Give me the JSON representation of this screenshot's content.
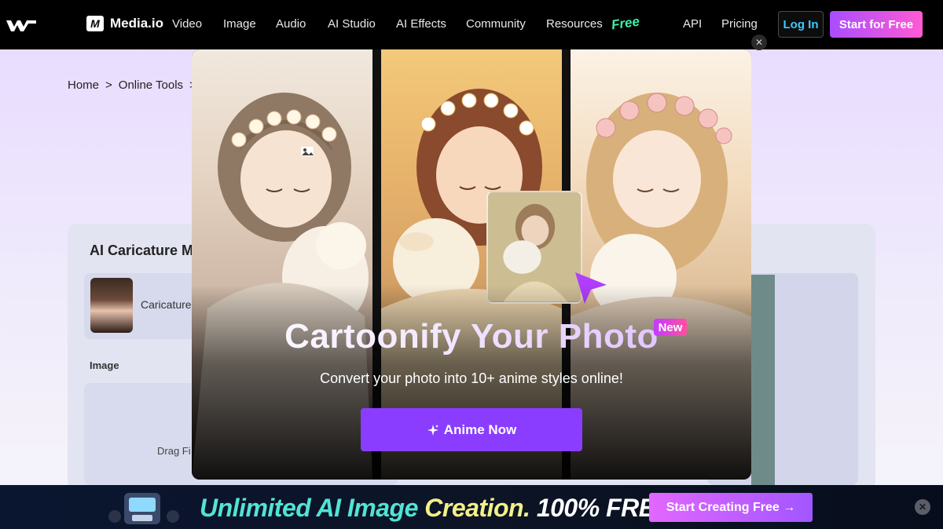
{
  "header": {
    "brand": "Media.io",
    "brand_mark": "M",
    "nav": [
      "Video",
      "Image",
      "Audio",
      "AI Studio",
      "AI Effects",
      "Community",
      "Resources"
    ],
    "free_tag": "Free",
    "api": "API",
    "pricing": "Pricing",
    "login": "Log In",
    "start": "Start for Free"
  },
  "page": {
    "breadcrumb": [
      "Home",
      ">",
      "Online Tools",
      ">"
    ],
    "tool_title": "AI Caricature M",
    "style_label": "Caricature",
    "image_label": "Image",
    "drop_text": "Drag Fi"
  },
  "modal": {
    "title": "Cartoonify Your Photo",
    "badge": "New",
    "subtitle": "Convert your photo into 10+ anime styles online!",
    "cta": "Anime Now",
    "cta_icon": "sparkle-icon",
    "close": "✕"
  },
  "banner": {
    "headline_a": "Unlimited AI Image ",
    "headline_b": "Creation.",
    "headline_c": " 100% FREE!",
    "cta": "Start Creating Free →",
    "close": "✕"
  },
  "colors": {
    "accent_purple": "#8a3dff",
    "login_blue": "#3ec9ff",
    "free_green": "#3cf0a8"
  }
}
